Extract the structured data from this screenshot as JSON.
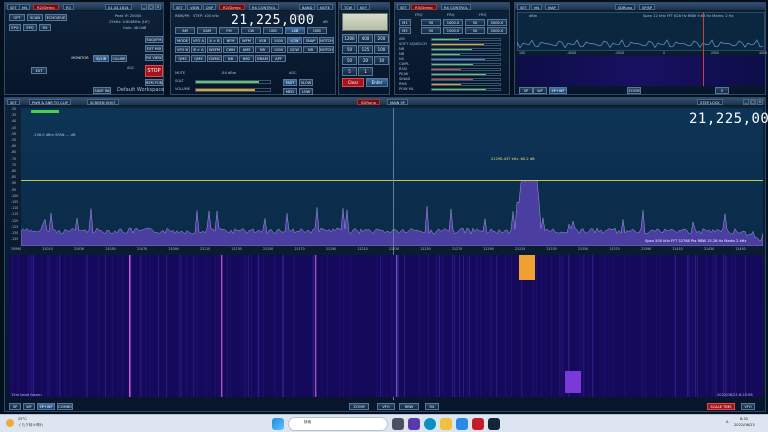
{
  "colors": {
    "accent": "#d84848",
    "spectrum": "#5a4fb0",
    "cursor": "#c8c84a",
    "waterfall": "#1a0f54"
  },
  "p1": {
    "tabs": [
      "SET",
      "M4",
      "R2/Demo",
      "R3",
      "-",
      "01.43.1814"
    ],
    "btns": [
      "OPT",
      "SCAN",
      "ECHO/EUE",
      "EPQ",
      "EPQ",
      "RX",
      "MONITOR",
      "IQ/LIB",
      "CALIBR",
      "EAQ/IFM",
      "EXT",
      "EXT MIX",
      "RX VIEW",
      "SPD/CTRL",
      "REC LOCK",
      "STOP",
      "REM FUN",
      "SAVE INI",
      "AGC"
    ],
    "info": [
      "Peak IF: 20000",
      "25kHz: 0.608MHz (LIF)",
      "Gain: 48.0dB"
    ],
    "title": "Default Workspace"
  },
  "p2": {
    "tabs": [
      "SET",
      "VIEW",
      "DSP",
      "R2/Demo",
      "RX CONTROL",
      "BAND",
      "NOTE"
    ],
    "rssi": "RBW/PH",
    "step": "STEP: 100 kHz",
    "freq": "21,225,000",
    "dbm": "-109.6 dBm",
    "unit": "dB",
    "modes": [
      "AM",
      "SAM",
      "FM",
      "CW",
      "USB",
      "LSB",
      "DSB"
    ],
    "rows": [
      [
        "MODE",
        "VFO A",
        "A > B",
        "NFM",
        "WFM",
        "USB",
        "1000",
        "LCW",
        "SNAP",
        "NOTCH"
      ],
      [
        "VFO B",
        "B > A",
        "WSFM",
        "CWN",
        "AMS",
        "NR",
        "1000",
        "DCW",
        "NR",
        "NOTCH2"
      ],
      [
        "QMS",
        "QMX",
        "CWMC",
        "NB",
        "NR2",
        "BRAM",
        "APF"
      ]
    ],
    "labels": [
      "MUTE",
      "SQLT",
      "VOLUME",
      "AGC",
      "FAST",
      "SLOW",
      "MED",
      "LOW"
    ],
    "sq": "-84 dBm"
  },
  "p3": {
    "tabs": [
      "TCW",
      "KEY",
      "M"
    ],
    "grid": [
      "1200",
      "400",
      "200",
      "50",
      "125",
      "100",
      "50",
      "20",
      "10",
      "5",
      "1",
      "Clear",
      "Enter"
    ]
  },
  "p4": {
    "tabs": [
      "SET",
      "R3/Demo",
      "RX CONTROL"
    ],
    "cols": [
      "FRQ",
      "FRQ",
      "FRQ"
    ],
    "rows": [
      [
        "M1",
        "50",
        "1000.0",
        "50",
        "2000.0"
      ],
      [
        "M2",
        "50",
        "1500.0",
        "50",
        "2000.0"
      ]
    ],
    "labels": [
      "AM",
      "SOFT SQUELCH",
      "NR",
      "NB",
      "NS",
      "CWPL",
      "RSSI",
      "PEAK",
      "SINAD",
      "RMS",
      "POW ML"
    ],
    "extra": [
      "EXPAND",
      "SLOW",
      "ATTN"
    ]
  },
  "p5": {
    "tabs": [
      "SET",
      "M4",
      "MAP"
    ],
    "badge": "SDRuno",
    "sub": "SP/SP",
    "info": "Span 12 kHz  FFT 628 Hz  RBW 9.66 Hz  Marks: 2 Hz",
    "dbm": "dBm",
    "ticks": [
      "100",
      "-4000",
      "-2000",
      "0",
      "2000",
      "4000"
    ],
    "bot": [
      "SP",
      "WF",
      "SP+WF",
      "ZOOM",
      "0"
    ]
  },
  "main": {
    "tabs": [
      "SET",
      "PWR & SNR TO CLIP",
      "SCREEN SHOT"
    ],
    "badge": "SDRuno",
    "sub": "MAIN SP",
    "lock": "STEP LOCK",
    "freq": "21,225,000",
    "readout": "-106.0 dBm  SPAN --- dB",
    "peak": "21290.437 kHz  -60.2 dB",
    "yticks": [
      "-30",
      "-35",
      "-40",
      "-45",
      "-50",
      "-55",
      "-60",
      "-65",
      "-70",
      "-75",
      "-80",
      "-85",
      "-90",
      "-95",
      "-100",
      "-105",
      "-110",
      "-115",
      "-120",
      "-125",
      "-130",
      "-135"
    ],
    "xticks": [
      "20990",
      "21010",
      "21030",
      "21050",
      "21070",
      "21090",
      "21110",
      "21130",
      "21150",
      "21170",
      "21190",
      "21210",
      "21230",
      "21250",
      "21270",
      "21290",
      "21310",
      "21330",
      "21350",
      "21370",
      "21390",
      "21410",
      "21430",
      "21450"
    ],
    "span": "Span 500 kHz   FFT 32768 Pts   RBW 15.26 Hz  Marks 2 kHz",
    "band": "15m band frozen",
    "date": "2022/06/23 8:25:08",
    "bot": [
      "SP",
      "WF",
      "SP+WF",
      "COMBO",
      "ZOOM",
      "VFO",
      "RBW",
      "RX",
      "SCALE TIME",
      "VFO"
    ]
  },
  "taskbar": {
    "weather": "25°C",
    "weather2": "くもり時々晴れ",
    "search": "検索",
    "time": "8:32",
    "date": "2022/06/23",
    "lang": "A"
  }
}
